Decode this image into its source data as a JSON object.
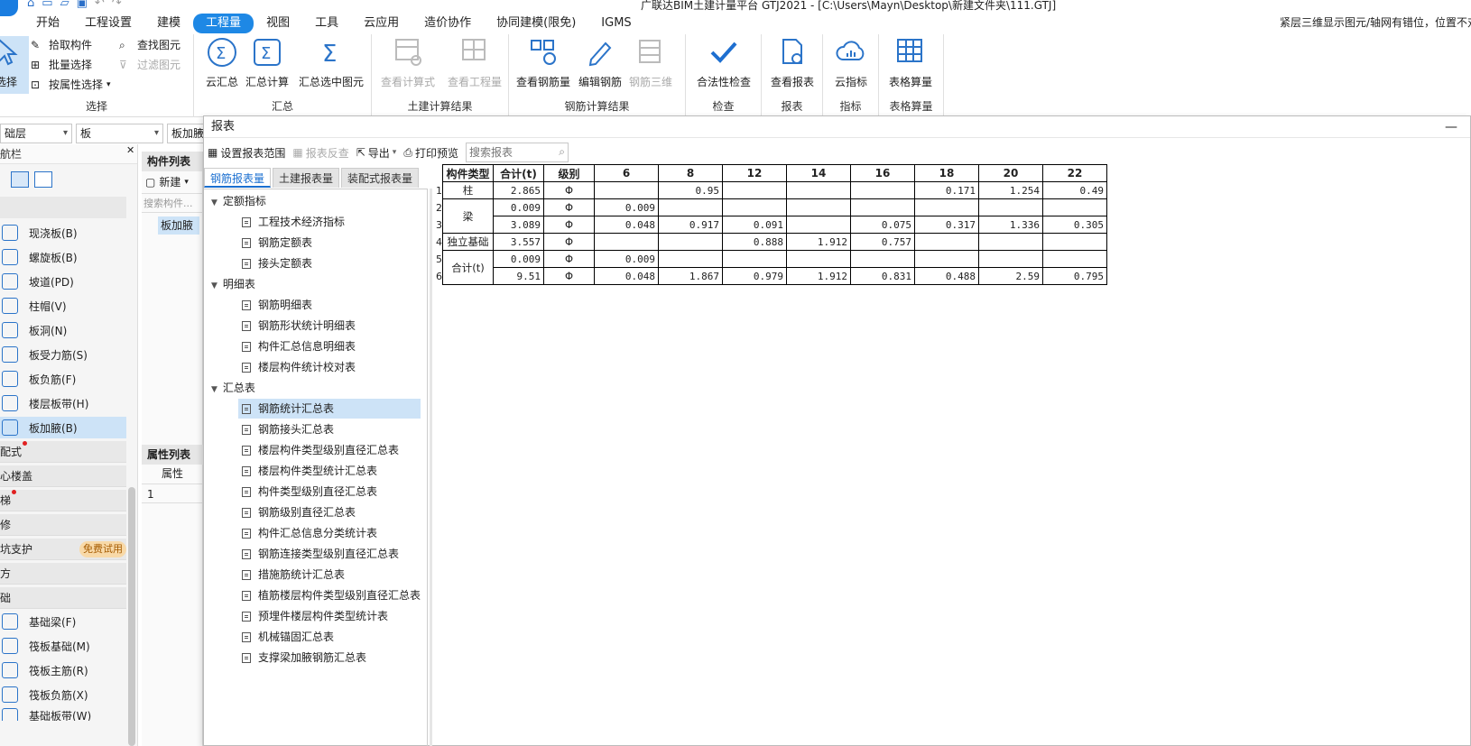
{
  "window": {
    "title": "广联达BIM土建计量平台 GTJ2021 - [C:\\Users\\Mayn\\Desktop\\新建文件夹\\111.GTJ]",
    "status_right": "紧层三维显示图元/轴网有错位，位置不对"
  },
  "menu": [
    "开始",
    "工程设置",
    "建模",
    "工程量",
    "视图",
    "工具",
    "云应用",
    "造价协作",
    "协同建模(限免)",
    "IGMS"
  ],
  "ribbon": {
    "select": {
      "big_label": "选择",
      "pick": "拾取构件",
      "batch": "批量选择",
      "by_attr": "按属性选择",
      "find": "查找图元",
      "filter": "过滤图元",
      "group": "选择"
    },
    "summary": {
      "cloud": "云汇总",
      "calc": "汇总计算",
      "calc_selected": "汇总选中图元",
      "group": "汇总"
    },
    "civil": {
      "formula": "查看计算式",
      "quantity": "查看工程量",
      "group": "土建计算结果"
    },
    "rebar": {
      "view": "查看钢筋量",
      "edit": "编辑钢筋",
      "threed": "钢筋三维",
      "group": "钢筋计算结果"
    },
    "check": {
      "legal": "合法性检查",
      "group": "检查"
    },
    "report": {
      "view": "查看报表",
      "group": "报表"
    },
    "index": {
      "cloud": "云指标",
      "group": "指标"
    },
    "table": {
      "calc": "表格算量",
      "group": "表格算量"
    }
  },
  "filters": {
    "layer": "础层",
    "type": "板",
    "sub": "板加腋"
  },
  "left_nav": {
    "title": "航栏",
    "items": [
      "现浇板(B)",
      "螺旋板(B)",
      "坡道(PD)",
      "柱帽(V)",
      "板洞(N)",
      "板受力筋(S)",
      "板负筋(F)",
      "楼层板带(H)",
      "板加腋(B)"
    ],
    "categories": [
      "配式",
      "心楼盖",
      "梯",
      "修",
      "坑支护",
      "方",
      "础"
    ],
    "trial": "免费试用",
    "items2": [
      "基础梁(F)",
      "筏板基础(M)",
      "筏板主筋(R)",
      "筏板负筋(X)",
      "基础板带(W)"
    ]
  },
  "mid_panel": {
    "title": "构件列表",
    "new_label": "新建",
    "search_placeholder": "搜索构件...",
    "item": "板加腋",
    "prop_title": "属性列表",
    "prop_col": "属性",
    "row1": "1"
  },
  "dialog": {
    "title": "报表",
    "toolbar": {
      "range": "设置报表范围",
      "reverse": "报表反查",
      "export": "导出",
      "print": "打印预览",
      "search_placeholder": "搜索报表"
    },
    "tabs": [
      "钢筋报表量",
      "土建报表量",
      "装配式报表量"
    ],
    "tree": {
      "g1": "定额指标",
      "g1_items": [
        "工程技术经济指标",
        "钢筋定额表",
        "接头定额表"
      ],
      "g2": "明细表",
      "g2_items": [
        "钢筋明细表",
        "钢筋形状统计明细表",
        "构件汇总信息明细表",
        "楼层构件统计校对表"
      ],
      "g3": "汇总表",
      "g3_items": [
        "钢筋统计汇总表",
        "钢筋接头汇总表",
        "楼层构件类型级别直径汇总表",
        "楼层构件类型统计汇总表",
        "构件类型级别直径汇总表",
        "钢筋级别直径汇总表",
        "构件汇总信息分类统计表",
        "钢筋连接类型级别直径汇总表",
        "措施筋统计汇总表",
        "植筋楼层构件类型级别直径汇总表",
        "预埋件楼层构件类型统计表",
        "机械锚固汇总表",
        "支撑梁加腋钢筋汇总表"
      ]
    }
  },
  "report_table": {
    "headers": [
      "构件类型",
      "合计(t)",
      "级别",
      "6",
      "8",
      "12",
      "14",
      "16",
      "18",
      "20",
      "22"
    ],
    "rows": [
      {
        "n": "1",
        "type": "柱",
        "total": "2.865",
        "grade": "Φ",
        "v": [
          "",
          "0.95",
          "",
          "",
          "",
          "0.171",
          "1.254",
          "0.49"
        ]
      },
      {
        "n": "2",
        "type": "梁",
        "total": "0.009",
        "grade": "Φ",
        "v": [
          "0.009",
          "",
          "",
          "",
          "",
          "",
          "",
          ""
        ]
      },
      {
        "n": "3",
        "type": "",
        "total": "3.089",
        "grade": "Φ",
        "v": [
          "0.048",
          "0.917",
          "0.091",
          "",
          "0.075",
          "0.317",
          "1.336",
          "0.305"
        ]
      },
      {
        "n": "4",
        "type": "独立基础",
        "total": "3.557",
        "grade": "Φ",
        "v": [
          "",
          "",
          "0.888",
          "1.912",
          "0.757",
          "",
          "",
          ""
        ]
      },
      {
        "n": "5",
        "type": "合计(t)",
        "total": "0.009",
        "grade": "Φ",
        "v": [
          "0.009",
          "",
          "",
          "",
          "",
          "",
          "",
          ""
        ]
      },
      {
        "n": "6",
        "type": "",
        "total": "9.51",
        "grade": "Φ",
        "v": [
          "0.048",
          "1.867",
          "0.979",
          "1.912",
          "0.831",
          "0.488",
          "2.59",
          "0.795"
        ]
      }
    ]
  },
  "colors": {
    "accent": "#1e88e5",
    "selected": "#cde3f7",
    "icon": "#2b74c9"
  }
}
